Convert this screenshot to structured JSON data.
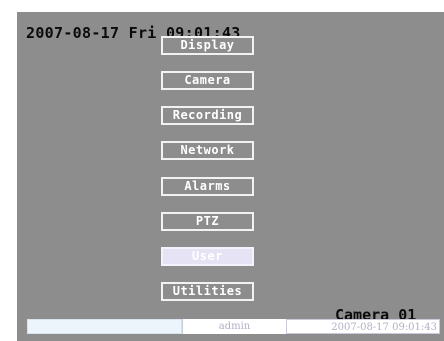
{
  "osd": {
    "datetime": "2007-08-17 Fri 09:01:43",
    "camera_name": "Camera 01"
  },
  "menu": {
    "items": [
      {
        "label": "Display"
      },
      {
        "label": "Camera"
      },
      {
        "label": "Recording"
      },
      {
        "label": "Network"
      },
      {
        "label": "Alarms"
      },
      {
        "label": "PTZ"
      },
      {
        "label": "User"
      },
      {
        "label": "Utilities"
      }
    ],
    "selected_label": "User"
  },
  "status_bar": {
    "field1": "",
    "user": "admin",
    "time": "2007-08-17 09:01:43"
  },
  "colors": {
    "video_background": "#8d8d8d",
    "osd_text": "#0b0b0b",
    "button_border": "#f2f2f2",
    "selected_fill": "#e6e3f4",
    "status_text": "#b0b0c8"
  }
}
